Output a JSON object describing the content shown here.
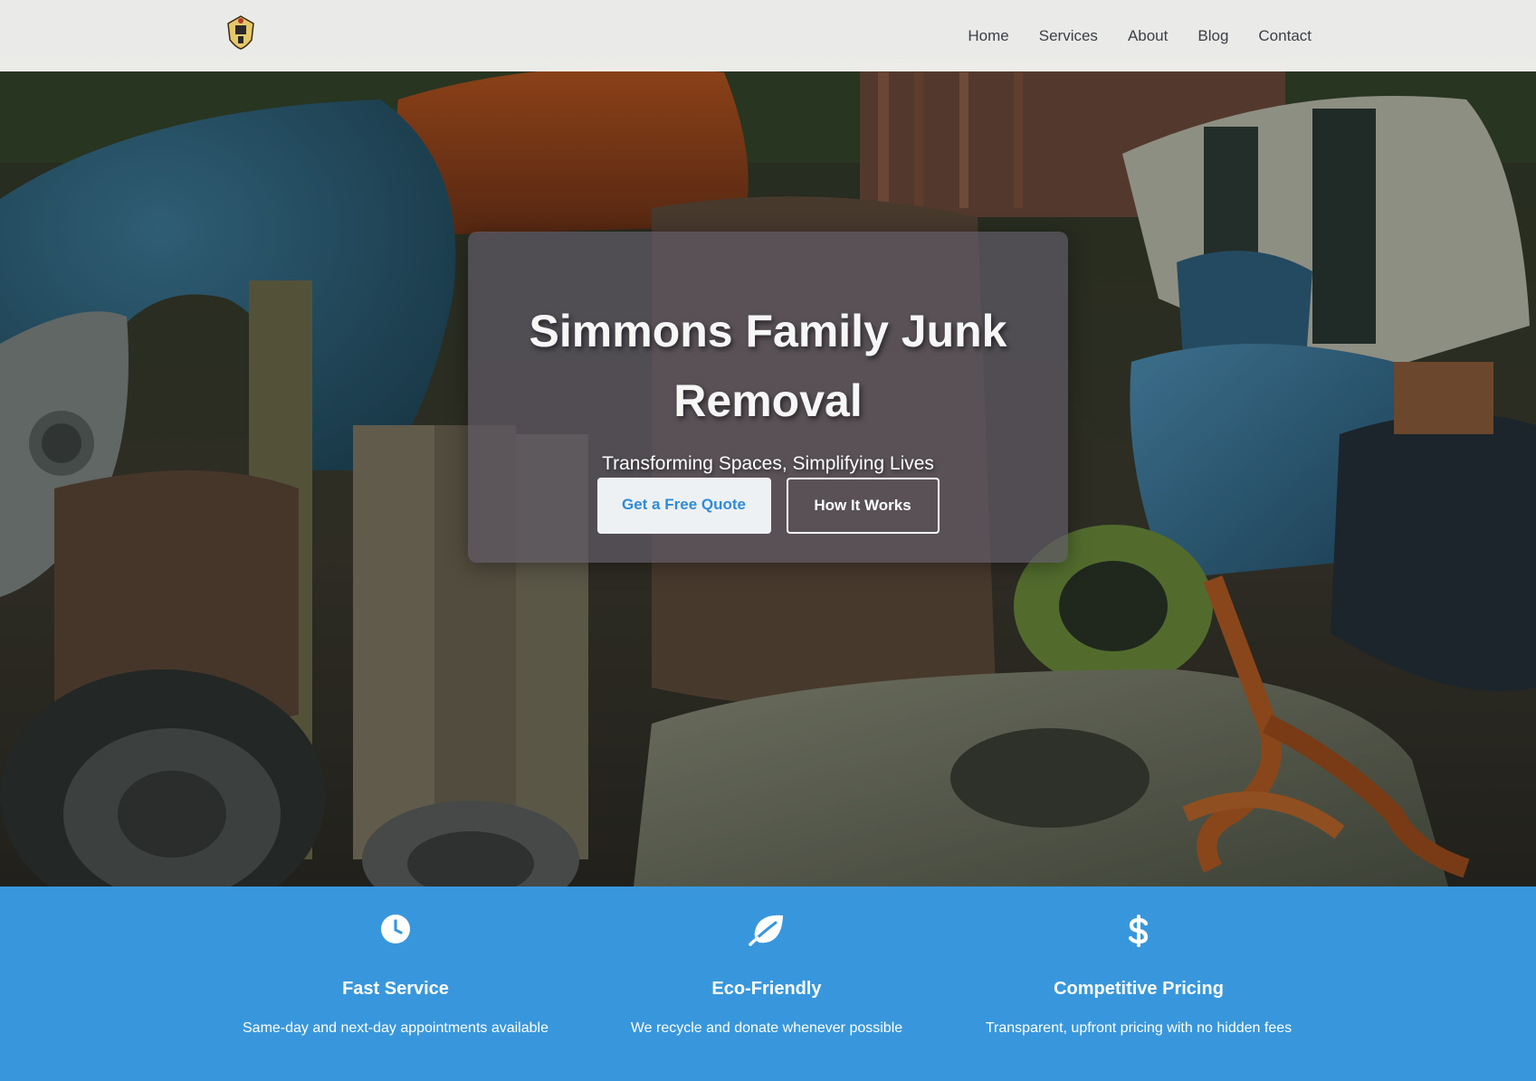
{
  "nav": {
    "logo_icon": "family-crest-logo",
    "items": [
      {
        "label": "Home"
      },
      {
        "label": "Services"
      },
      {
        "label": "About"
      },
      {
        "label": "Blog"
      },
      {
        "label": "Contact"
      }
    ]
  },
  "hero": {
    "title": "Simmons Family Junk Removal",
    "subtitle": "Transforming Spaces, Simplifying Lives",
    "primary_button": "Get a Free Quote",
    "secondary_button": "How It Works",
    "background": "junkyard-photo"
  },
  "features": [
    {
      "icon": "clock-icon",
      "title": "Fast Service",
      "description": "Same-day and next-day appointments available"
    },
    {
      "icon": "leaf-icon",
      "title": "Eco-Friendly",
      "description": "We recycle and donate whenever possible"
    },
    {
      "icon": "dollar-icon",
      "title": "Competitive Pricing",
      "description": "Transparent, upfront pricing with no hidden fees"
    }
  ],
  "colors": {
    "accent": "#3897dc",
    "nav_text": "#3b3f47",
    "primary_button_text": "#2f8bd8"
  }
}
